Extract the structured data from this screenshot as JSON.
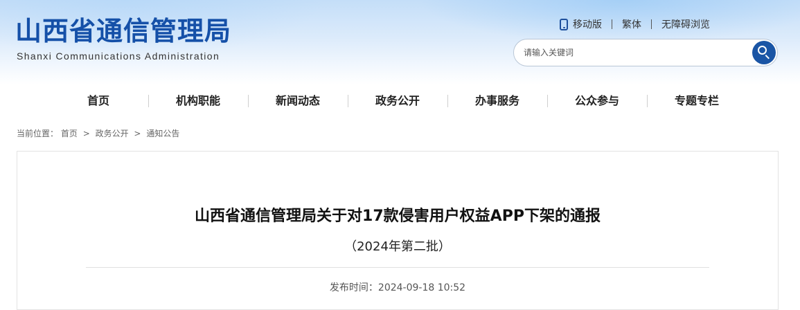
{
  "header": {
    "title": "山西省通信管理局",
    "subtitle": "Shanxi Communications Administration"
  },
  "top_links": {
    "mobile": "移动版",
    "traditional": "繁体",
    "accessible": "无障碍浏览"
  },
  "search": {
    "placeholder": "请输入关键词"
  },
  "nav": {
    "items": [
      "首页",
      "机构职能",
      "新闻动态",
      "政务公开",
      "办事服务",
      "公众参与",
      "专题专栏"
    ]
  },
  "breadcrumb": {
    "label": "当前位置：",
    "items": [
      "首页",
      "政务公开",
      "通知公告"
    ],
    "separator": ">"
  },
  "article": {
    "title": "山西省通信管理局关于对17款侵害用户权益APP下架的通报",
    "subtitle": "（2024年第二批）",
    "publish_label": "发布时间：",
    "publish_time": "2024-09-18 10:52"
  },
  "colors": {
    "brand": "#1550a8",
    "search_button": "#1a55a5"
  },
  "icons": {
    "mobile": "mobile-phone-icon",
    "search": "search-icon"
  }
}
